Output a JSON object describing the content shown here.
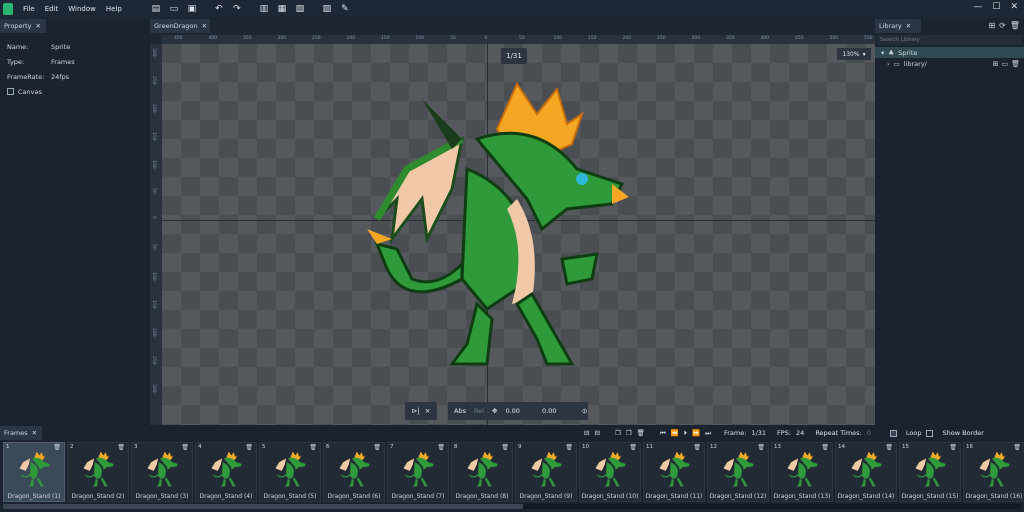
{
  "menu": {
    "file": "File",
    "edit": "Edit",
    "window": "Window",
    "help": "Help"
  },
  "property": {
    "tab": "Property",
    "rows": [
      {
        "k": "Name:",
        "v": "Sprite"
      },
      {
        "k": "Type:",
        "v": "Frames"
      },
      {
        "k": "FrameRate:",
        "v": "24fps"
      }
    ],
    "canvas_label": "Canvas"
  },
  "editor": {
    "tab": "GreenDragon",
    "frame_indicator": "1/31",
    "zoom": "130%",
    "ruler_top": [
      "450",
      "400",
      "350",
      "300",
      "250",
      "200",
      "150",
      "100",
      "50",
      "0",
      "50",
      "100",
      "150",
      "200",
      "250",
      "300",
      "350",
      "400",
      "450",
      "500",
      "550"
    ],
    "ruler_left": [
      "300",
      "250",
      "200",
      "150",
      "100",
      "50",
      "0",
      "50",
      "100",
      "150",
      "200",
      "250",
      "300"
    ],
    "controls": {
      "abs": "Abs",
      "rel": "Rel",
      "x": "0.00",
      "y": "0.00"
    }
  },
  "library": {
    "tab": "Library",
    "search_placeholder": "Search Library",
    "items": [
      {
        "label": "Sprite"
      },
      {
        "label": "library/"
      }
    ]
  },
  "frames": {
    "tab": "Frames",
    "frame_label": "Frame:",
    "frame_value": "1/31",
    "fps_label": "FPS:",
    "fps_value": "24",
    "repeat_label": "Repeat Times:",
    "repeat_value": "0",
    "loop_label": "Loop",
    "border_label": "Show Border",
    "items": [
      {
        "n": "1",
        "name": "Dragon_Stand (1)"
      },
      {
        "n": "2",
        "name": "Dragon_Stand (2)"
      },
      {
        "n": "3",
        "name": "Dragon_Stand (3)"
      },
      {
        "n": "4",
        "name": "Dragon_Stand (4)"
      },
      {
        "n": "5",
        "name": "Dragon_Stand (5)"
      },
      {
        "n": "6",
        "name": "Dragon_Stand (6)"
      },
      {
        "n": "7",
        "name": "Dragon_Stand (7)"
      },
      {
        "n": "8",
        "name": "Dragon_Stand (8)"
      },
      {
        "n": "9",
        "name": "Dragon_Stand (9)"
      },
      {
        "n": "10",
        "name": "Dragon_Stand (10)"
      },
      {
        "n": "11",
        "name": "Dragon_Stand (11)"
      },
      {
        "n": "12",
        "name": "Dragon_Stand (12)"
      },
      {
        "n": "13",
        "name": "Dragon_Stand (13)"
      },
      {
        "n": "14",
        "name": "Dragon_Stand (14)"
      },
      {
        "n": "15",
        "name": "Dragon_Stand (15)"
      },
      {
        "n": "16",
        "name": "Dragon_Stand (16)"
      }
    ]
  },
  "colors": {
    "accent": "#2bb673",
    "selected_row": "#2f4a52"
  }
}
